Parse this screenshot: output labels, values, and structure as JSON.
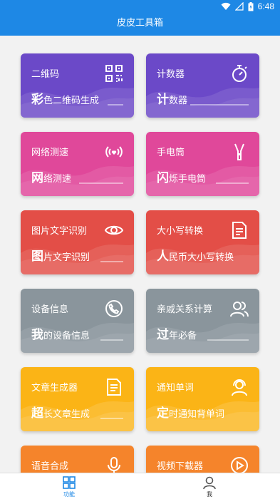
{
  "status_bar": {
    "time": "6:48"
  },
  "app_bar": {
    "title": "皮皮工具箱"
  },
  "cards": [
    {
      "title": "二维码",
      "sub_first": "彩",
      "sub_rest": "色二维码生成",
      "icon": "qr-code-icon",
      "color": "#6b49c8"
    },
    {
      "title": "计数器",
      "sub_first": "计",
      "sub_rest": "数器",
      "icon": "stopwatch-icon",
      "color": "#6b49c8"
    },
    {
      "title": "网络测速",
      "sub_first": "网",
      "sub_rest": "络测速",
      "icon": "signal-heart-icon",
      "color": "#e0489a"
    },
    {
      "title": "手电筒",
      "sub_first": "闪",
      "sub_rest": "烁手电筒",
      "icon": "flashlight-icon",
      "color": "#e0489a"
    },
    {
      "title": "图片文字识别",
      "sub_first": "图",
      "sub_rest": "片文字识别",
      "icon": "eye-icon",
      "color": "#e34e47"
    },
    {
      "title": "大小写转换",
      "sub_first": "人",
      "sub_rest": "民币大小写转换",
      "icon": "document-icon",
      "color": "#e34e47"
    },
    {
      "title": "设备信息",
      "sub_first": "我",
      "sub_rest": "的设备信息",
      "icon": "phone-icon",
      "color": "#8a959c"
    },
    {
      "title": "亲戚关系计算",
      "sub_first": "过",
      "sub_rest": "年必备",
      "icon": "people-icon",
      "color": "#8a959c"
    },
    {
      "title": "文章生成器",
      "sub_first": "超",
      "sub_rest": "长文章生成",
      "icon": "article-icon",
      "color": "#fbb416"
    },
    {
      "title": "通知单词",
      "sub_first": "定",
      "sub_rest": "时通知背单词",
      "icon": "headset-icon",
      "color": "#fbb416"
    },
    {
      "title": "语音合成",
      "sub_first": "",
      "sub_rest": "",
      "icon": "microphone-icon",
      "color": "#f5842b"
    },
    {
      "title": "视频下载器",
      "sub_first": "",
      "sub_rest": "",
      "icon": "play-icon",
      "color": "#f5842b"
    }
  ],
  "bottom_nav": {
    "functions_label": "功能",
    "me_label": "我",
    "active_color": "#1e88e5"
  }
}
